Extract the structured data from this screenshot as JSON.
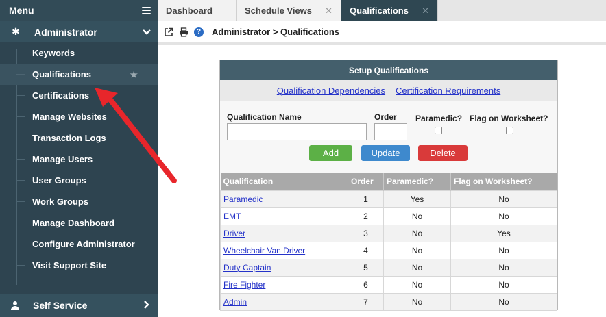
{
  "sidebar": {
    "menu_title": "Menu",
    "section_title": "Administrator",
    "items": [
      {
        "label": "Keywords"
      },
      {
        "label": "Qualifications"
      },
      {
        "label": "Certifications"
      },
      {
        "label": "Manage Websites"
      },
      {
        "label": "Transaction Logs"
      },
      {
        "label": "Manage Users"
      },
      {
        "label": "User Groups"
      },
      {
        "label": "Work Groups"
      },
      {
        "label": "Manage Dashboard"
      },
      {
        "label": "Configure Administrator"
      },
      {
        "label": "Visit Support Site"
      }
    ],
    "active_item": "Qualifications",
    "footer_section": "Self Service"
  },
  "tabs": [
    {
      "label": "Dashboard",
      "closable": false
    },
    {
      "label": "Schedule Views",
      "closable": true
    },
    {
      "label": "Qualifications",
      "closable": true,
      "active": true
    }
  ],
  "toolbar": {
    "breadcrumb": "Administrator > Qualifications",
    "icons": [
      "external-link-icon",
      "print-icon",
      "help-icon"
    ]
  },
  "panel": {
    "title": "Setup Qualifications",
    "links": [
      "Qualification Dependencies",
      "Certification Requirements"
    ],
    "form": {
      "name_label": "Qualification Name",
      "order_label": "Order",
      "paramedic_label": "Paramedic?",
      "flag_label": "Flag on Worksheet?",
      "name_value": "",
      "order_value": "",
      "add_label": "Add",
      "update_label": "Update",
      "delete_label": "Delete"
    },
    "table": {
      "headers": [
        "Qualification",
        "Order",
        "Paramedic?",
        "Flag on Worksheet?"
      ],
      "rows": [
        {
          "qualification": "Paramedic",
          "order": "1",
          "paramedic": "Yes",
          "flag": "No"
        },
        {
          "qualification": "EMT",
          "order": "2",
          "paramedic": "No",
          "flag": "No"
        },
        {
          "qualification": "Driver",
          "order": "3",
          "paramedic": "No",
          "flag": "Yes"
        },
        {
          "qualification": "Wheelchair Van Driver",
          "order": "4",
          "paramedic": "No",
          "flag": "No"
        },
        {
          "qualification": "Duty Captain",
          "order": "5",
          "paramedic": "No",
          "flag": "No"
        },
        {
          "qualification": "Fire Fighter",
          "order": "6",
          "paramedic": "No",
          "flag": "No"
        },
        {
          "qualification": "Admin",
          "order": "7",
          "paramedic": "No",
          "flag": "No"
        }
      ]
    }
  },
  "colors": {
    "sidebar_bg": "#2e4450",
    "active_tab_bg": "#2f4752",
    "panel_header_bg": "#445f6c",
    "add_button": "#5cb046",
    "update_button": "#3e89cd",
    "delete_button": "#d93a3a",
    "annotation_arrow": "#e8262b"
  }
}
